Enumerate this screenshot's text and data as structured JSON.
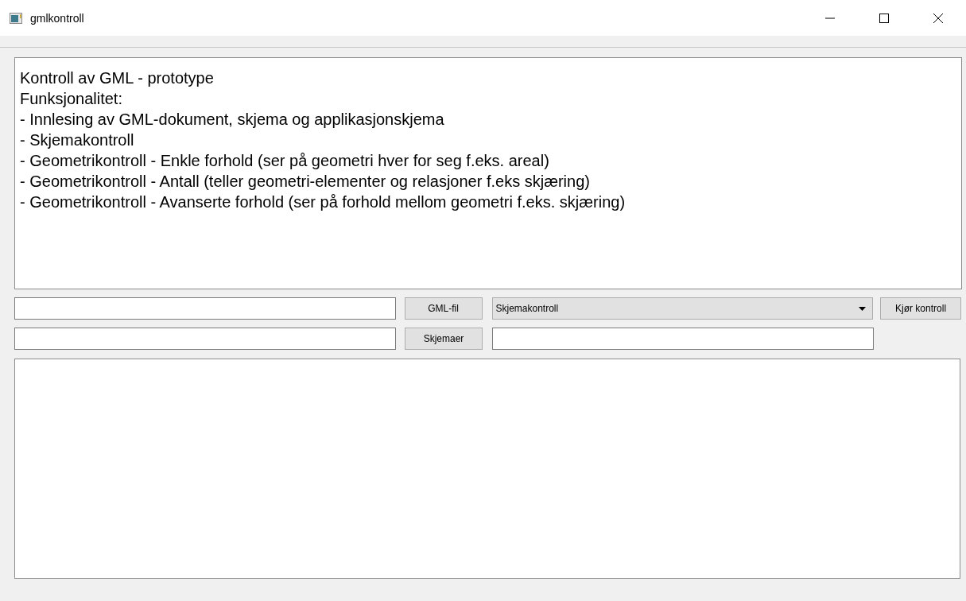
{
  "window": {
    "title": "gmlkontroll"
  },
  "description": {
    "lines": [
      "Kontroll av GML - prototype",
      "Funksjonalitet:",
      "- Innlesing av GML-dokument, skjema og applikasjonskjema",
      "- Skjemakontroll",
      "- Geometrikontroll - Enkle forhold (ser på geometri hver for seg f.eks. areal)",
      "- Geometrikontroll - Antall (teller geometri-elementer og relasjoner f.eks skjæring)",
      "- Geometrikontroll - Avanserte forhold (ser på forhold mellom geometri f.eks. skjæring)"
    ]
  },
  "gml_button": "GML-fil",
  "check_select": {
    "value": "Skjemakontroll"
  },
  "run_button": "Kjør kontroll",
  "schema_button": "Skjemaer"
}
